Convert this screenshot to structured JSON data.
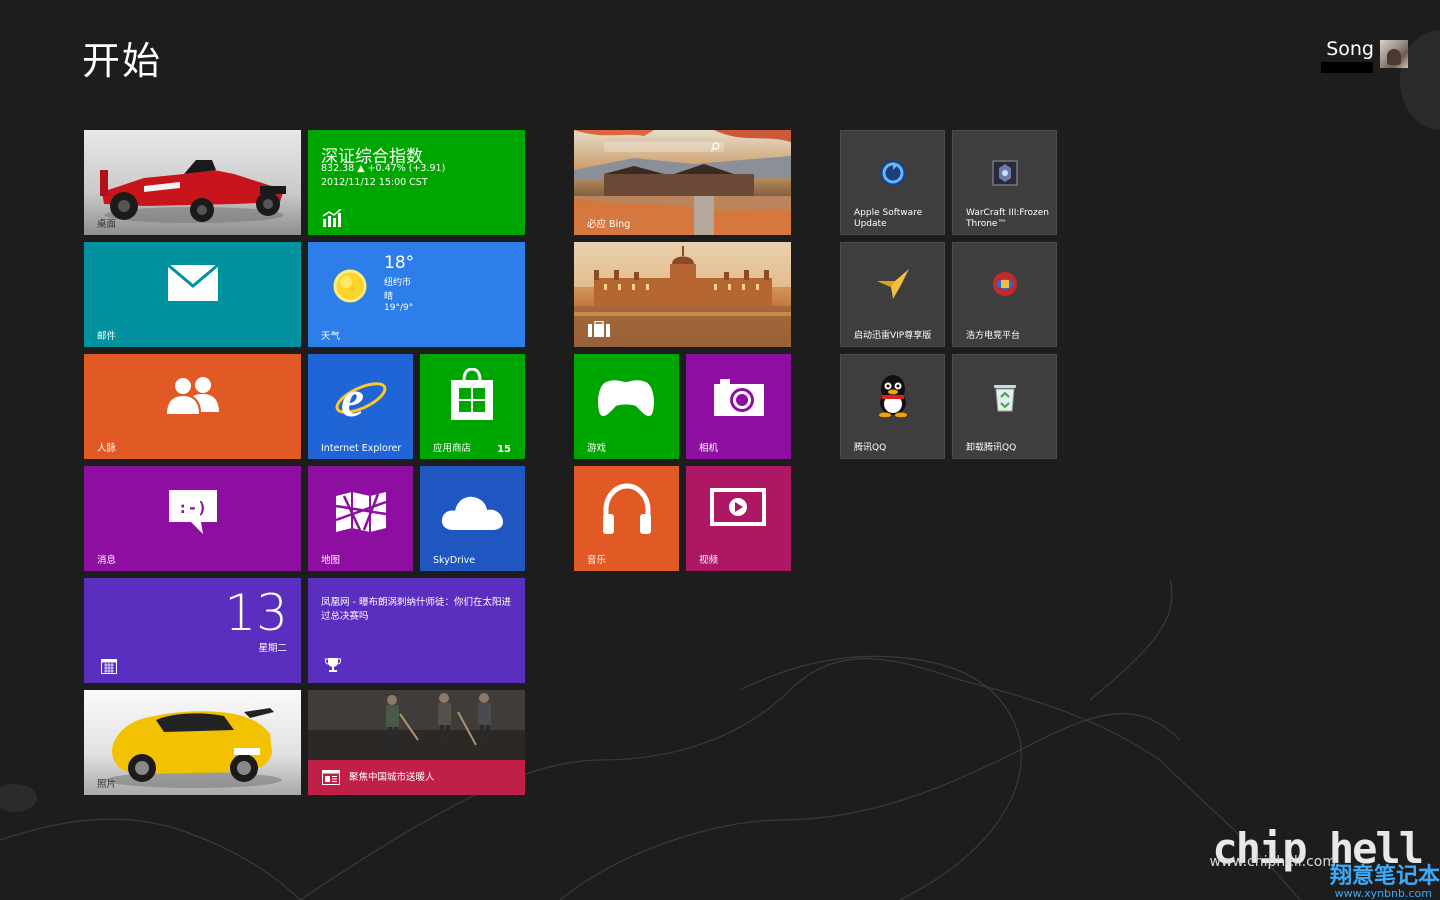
{
  "screen": {
    "title": "开始"
  },
  "user": {
    "name": "Song"
  },
  "colors": {
    "background": "#1d1d1d",
    "green": "#00a600",
    "teal": "#00929f",
    "blue": "#2d7ee8",
    "orange": "#e15a26",
    "purple": "#8e0ea1",
    "violet": "#5a2ebf",
    "magenta": "#ad1763",
    "skyblue": "#1f56c2"
  },
  "tiles": {
    "desktop": {
      "label": "桌面",
      "icon": "formula-one-car-picture"
    },
    "finance": {
      "title": "深证综合指数",
      "line1": "832.38 ▲ +0.47% (+3.91)",
      "line2": "2012/11/12 15:00 CST",
      "icon": "chart-icon"
    },
    "bing": {
      "label": "必应 Bing",
      "icon": "search-icon"
    },
    "travel": {
      "label": "",
      "icon": "suitcase-icon"
    },
    "mail": {
      "label": "邮件",
      "icon": "envelope-icon"
    },
    "weather": {
      "temp": "18°",
      "city": "纽约市",
      "condition": "晴",
      "range": "19°/9°",
      "label": "天气",
      "icon": "sun-icon"
    },
    "people": {
      "label": "人脉",
      "icon": "people-icon"
    },
    "ie": {
      "label": "Internet Explorer",
      "icon": "internet-explorer-icon"
    },
    "store": {
      "label": "应用商店",
      "badge": "15",
      "icon": "store-bag-icon"
    },
    "games": {
      "label": "游戏",
      "icon": "xbox-controller-icon"
    },
    "camera": {
      "label": "相机",
      "icon": "camera-icon"
    },
    "messaging": {
      "label": "消息",
      "icon": "chat-bubble-icon"
    },
    "maps": {
      "label": "地图",
      "icon": "map-icon"
    },
    "skydrive": {
      "label": "SkyDrive",
      "icon": "cloud-icon"
    },
    "music": {
      "label": "音乐",
      "icon": "headphones-icon"
    },
    "video": {
      "label": "视频",
      "icon": "play-screen-icon"
    },
    "calendar": {
      "day": "13",
      "weekday": "星期二",
      "icon": "calendar-icon"
    },
    "sports": {
      "text": "凤凰网 - 曝布朗涡刺纳什师徒：你们在太阳进过总决赛吗",
      "icon": "trophy-icon"
    },
    "photos": {
      "label": "照片",
      "icon": "yellow-sports-car-picture"
    },
    "news": {
      "text": "聚焦中国城市送暖人",
      "icon": "newspaper-icon"
    },
    "apple_update": {
      "label": "Apple Software Update",
      "icon": "apple-update-icon"
    },
    "warcraft": {
      "label": "WarCraft III:Frozen Throne™",
      "icon": "warcraft-icon"
    },
    "xunlei": {
      "label": "启动迅雷VIP尊享版",
      "icon": "xunlei-bird-icon"
    },
    "haofang": {
      "label": "浩方电竞平台",
      "icon": "haofang-icon"
    },
    "qq": {
      "label": "腾讯QQ",
      "icon": "qq-penguin-icon"
    },
    "uninstall_qq": {
      "label": "卸载腾讯QQ",
      "icon": "recycle-bin-icon"
    }
  },
  "watermark": {
    "brand": "chip hell",
    "url": "www.chiphell.com",
    "site_cn": "翔意笔记本",
    "site_url": "www.xynbnb.com"
  }
}
